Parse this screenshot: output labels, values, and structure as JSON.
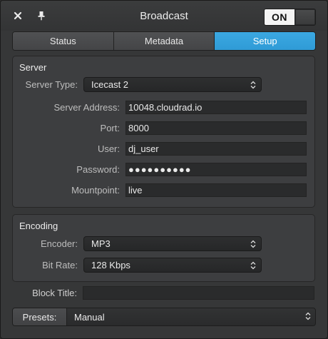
{
  "window": {
    "title": "Broadcast",
    "toggle_label": "ON"
  },
  "tabs": [
    {
      "label": "Status",
      "active": false
    },
    {
      "label": "Metadata",
      "active": false
    },
    {
      "label": "Setup",
      "active": true
    }
  ],
  "server": {
    "section_title": "Server",
    "server_type_label": "Server Type:",
    "server_type_value": "Icecast 2",
    "address_label": "Server Address:",
    "address_value": "10048.cloudrad.io",
    "port_label": "Port:",
    "port_value": "8000",
    "user_label": "User:",
    "user_value": "dj_user",
    "password_label": "Password:",
    "password_value": "●●●●●●●●●●",
    "mountpoint_label": "Mountpoint:",
    "mountpoint_value": "live"
  },
  "encoding": {
    "section_title": "Encoding",
    "encoder_label": "Encoder:",
    "encoder_value": "MP3",
    "bitrate_label": "Bit Rate:",
    "bitrate_value": "128 Kbps"
  },
  "block_title": {
    "label": "Block Title:",
    "value": ""
  },
  "presets": {
    "label": "Presets:",
    "value": "Manual"
  },
  "colors": {
    "accent": "#2f9bd6",
    "window_bg": "#363738",
    "group_bg": "#3d3e40"
  },
  "icons": {
    "close": "close-icon",
    "pin": "pin-icon",
    "popup_arrows": "up-down-chevron-icon"
  }
}
